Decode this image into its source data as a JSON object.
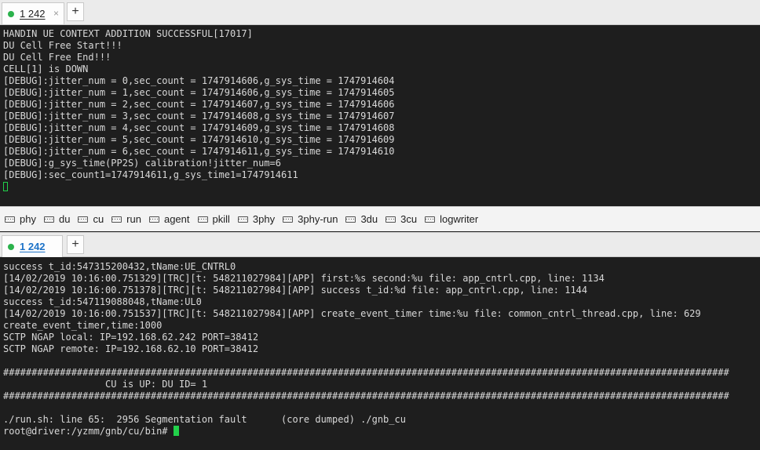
{
  "top_tab": {
    "label": "1 242",
    "close": "×"
  },
  "bottom_tab": {
    "label": "1 242"
  },
  "new_tab_label": "+",
  "top_terminal": {
    "lines": [
      "HANDIN UE CONTEXT ADDITION SUCCESSFUL[17017]",
      "DU Cell Free Start!!!",
      "DU Cell Free End!!!",
      "CELL[1] is DOWN",
      "[DEBUG]:jitter_num = 0,sec_count = 1747914606,g_sys_time = 1747914604",
      "[DEBUG]:jitter_num = 1,sec_count = 1747914606,g_sys_time = 1747914605",
      "[DEBUG]:jitter_num = 2,sec_count = 1747914607,g_sys_time = 1747914606",
      "[DEBUG]:jitter_num = 3,sec_count = 1747914608,g_sys_time = 1747914607",
      "[DEBUG]:jitter_num = 4,sec_count = 1747914609,g_sys_time = 1747914608",
      "[DEBUG]:jitter_num = 5,sec_count = 1747914610,g_sys_time = 1747914609",
      "[DEBUG]:jitter_num = 6,sec_count = 1747914611,g_sys_time = 1747914610",
      "[DEBUG]:g_sys_time(PP2S) calibration!jitter_num=6",
      "[DEBUG]:sec_count1=1747914611,g_sys_time1=1747914611"
    ]
  },
  "quickbar": {
    "items": [
      "phy",
      "du",
      "cu",
      "run",
      "agent",
      "pkill",
      "3phy",
      "3phy-run",
      "3du",
      "3cu",
      "logwriter"
    ]
  },
  "bottom_terminal": {
    "lines": [
      "success t_id:547315200432,tName:UE_CNTRL0",
      "[14/02/2019 10:16:00.751329][TRC][t: 548211027984][APP] first:%s second:%u file: app_cntrl.cpp, line: 1134",
      "[14/02/2019 10:16:00.751378][TRC][t: 548211027984][APP] success t_id:%d file: app_cntrl.cpp, line: 1144",
      "success t_id:547119088048,tName:UL0",
      "[14/02/2019 10:16:00.751537][TRC][t: 548211027984][APP] create_event_timer time:%u file: common_cntrl_thread.cpp, line: 629",
      "create_event_timer,time:1000",
      "SCTP NGAP local: IP=192.168.62.242 PORT=38412",
      "SCTP NGAP remote: IP=192.168.62.10 PORT=38412",
      "",
      "################################################################################################################################",
      "                  CU is UP: DU ID= 1",
      "################################################################################################################################",
      "",
      "./run.sh: line 65:  2956 Segmentation fault      (core dumped) ./gnb_cu"
    ],
    "prompt": "root@driver:/yzmm/gnb/cu/bin# "
  }
}
